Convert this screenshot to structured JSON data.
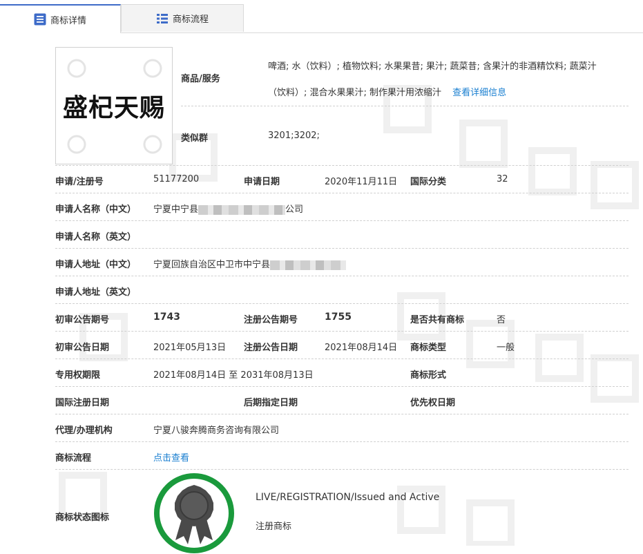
{
  "tabs": [
    {
      "label": "商标详情",
      "active": true,
      "icon": "list-icon"
    },
    {
      "label": "商标流程",
      "active": false,
      "icon": "grid-icon"
    }
  ],
  "trademark": {
    "logo_text": "盛杞天赐",
    "goods_label": "商品/服务",
    "goods_line1": "啤酒; 水（饮料）; 植物饮料; 水果果昔; 果汁; 蔬菜昔; 含果汁的非酒精饮料; 蔬菜汁",
    "goods_line2": "（饮料）; 混合水果果汁; 制作果汁用浓缩汁",
    "goods_link": "查看详细信息",
    "similar_group_label": "类似群",
    "similar_group_value": "3201;3202;"
  },
  "fields": {
    "reg_no_label": "申请/注册号",
    "reg_no": "51177200",
    "app_date_label": "申请日期",
    "app_date": "2020年11月11日",
    "intl_class_label": "国际分类",
    "intl_class": "32",
    "applicant_cn_label": "申请人名称（中文）",
    "applicant_cn_prefix": "宁夏中宁县",
    "applicant_cn_suffix": "公司",
    "applicant_en_label": "申请人名称（英文）",
    "address_cn_label": "申请人地址（中文）",
    "address_cn_prefix": "宁夏回族自治区中卫市中宁县",
    "address_en_label": "申请人地址（英文）",
    "prelim_pub_no_label": "初审公告期号",
    "prelim_pub_no": "1743",
    "reg_pub_no_label": "注册公告期号",
    "reg_pub_no": "1755",
    "shared_label": "是否共有商标",
    "shared": "否",
    "prelim_pub_date_label": "初审公告日期",
    "prelim_pub_date": "2021年05月13日",
    "reg_pub_date_label": "注册公告日期",
    "reg_pub_date": "2021年08月14日",
    "tm_type_label": "商标类型",
    "tm_type": "一般",
    "exclusive_label": "专用权期限",
    "exclusive": "2021年08月14日 至 2031年08月13日",
    "tm_form_label": "商标形式",
    "intl_reg_date_label": "国际注册日期",
    "later_designation_label": "后期指定日期",
    "priority_date_label": "优先权日期",
    "agent_label": "代理/办理机构",
    "agent": "宁夏八骏奔腾商务咨询有限公司",
    "flow_label": "商标流程",
    "flow_link": "点击查看",
    "status_label": "商标状态图标",
    "status_en": "LIVE/REGISTRATION/Issued and Active",
    "status_cn": "注册商标"
  },
  "colors": {
    "accent": "#3d6bc8",
    "link": "#1a7fd0",
    "status_ring": "#1a9a3c"
  }
}
